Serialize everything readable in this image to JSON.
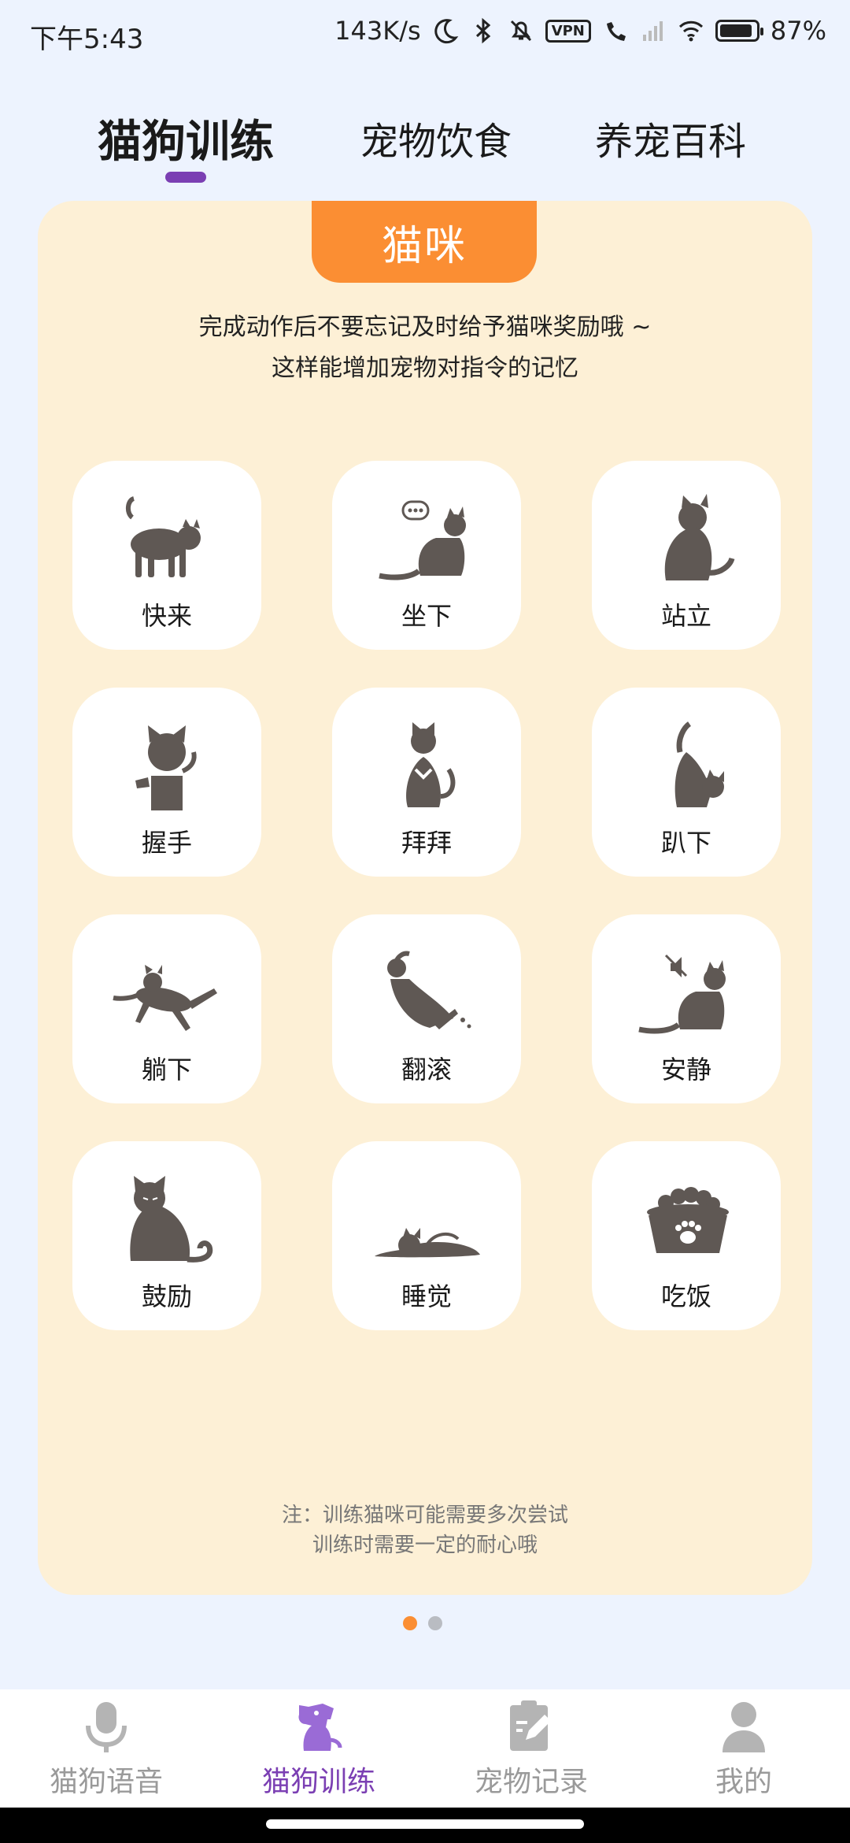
{
  "status_bar": {
    "time": "下午5:43",
    "speed": "143K/s",
    "vpn": "VPN",
    "battery": "87%"
  },
  "tabs": [
    {
      "label": "猫狗训练",
      "active": true
    },
    {
      "label": "宠物饮食",
      "active": false
    },
    {
      "label": "养宠百科",
      "active": false
    }
  ],
  "card": {
    "badge": "猫咪",
    "intro_line1": "完成动作后不要忘记及时给予猫咪奖励哦 ~",
    "intro_line2": "这样能增加宠物对指令的记忆",
    "commands": [
      {
        "label": "快来",
        "icon": "cat-walking-icon"
      },
      {
        "label": "坐下",
        "icon": "cat-sitting-icon"
      },
      {
        "label": "站立",
        "icon": "cat-standing-icon"
      },
      {
        "label": "握手",
        "icon": "cat-handshake-icon"
      },
      {
        "label": "拜拜",
        "icon": "cat-waving-icon"
      },
      {
        "label": "趴下",
        "icon": "cat-crouch-icon"
      },
      {
        "label": "躺下",
        "icon": "cat-lying-icon"
      },
      {
        "label": "翻滚",
        "icon": "cat-rolling-icon"
      },
      {
        "label": "安静",
        "icon": "cat-quiet-icon"
      },
      {
        "label": "鼓励",
        "icon": "cat-encourage-icon"
      },
      {
        "label": "睡觉",
        "icon": "cat-sleeping-icon"
      },
      {
        "label": "吃饭",
        "icon": "cat-food-bowl-icon"
      }
    ],
    "note_line1": "注：训练猫咪可能需要多次尝试",
    "note_line2": "训练时需要一定的耐心哦"
  },
  "pager": {
    "pages": 2,
    "current": 1
  },
  "bottom_nav": [
    {
      "label": "猫狗语音",
      "icon": "microphone-icon",
      "active": false
    },
    {
      "label": "猫狗训练",
      "icon": "dog-icon",
      "active": true
    },
    {
      "label": "宠物记录",
      "icon": "notepad-edit-icon",
      "active": false
    },
    {
      "label": "我的",
      "icon": "user-icon",
      "active": false
    }
  ],
  "colors": {
    "accent": "#7b3fb3",
    "badge": "#fb8e33",
    "card_bg": "#fdf0d6",
    "page_bg": "#edf3fe",
    "icon_gray": "#5f5854"
  }
}
